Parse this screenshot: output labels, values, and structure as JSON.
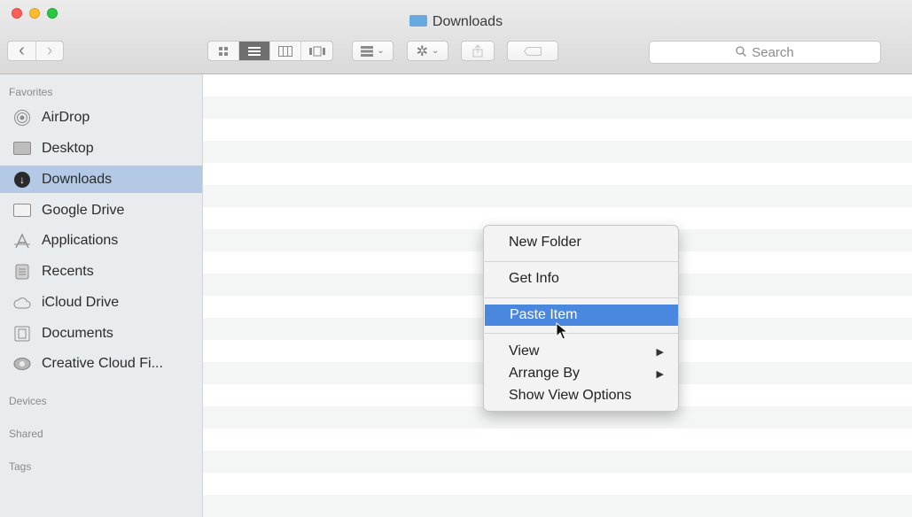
{
  "window": {
    "title": "Downloads"
  },
  "toolbar": {
    "back_icon": "‹",
    "forward_icon": "›",
    "view_modes": [
      "icon-view-icon",
      "list-view-icon",
      "column-view-icon",
      "gallery-view-icon"
    ],
    "active_view": "list",
    "search_placeholder": "Search"
  },
  "sidebar": {
    "favorites_label": "Favorites",
    "items": [
      {
        "label": "AirDrop",
        "icon": "airdrop-icon"
      },
      {
        "label": "Desktop",
        "icon": "desktop-icon"
      },
      {
        "label": "Downloads",
        "icon": "downloads-icon",
        "selected": true
      },
      {
        "label": "Google Drive",
        "icon": "folder-icon"
      },
      {
        "label": "Applications",
        "icon": "applications-icon"
      },
      {
        "label": "Recents",
        "icon": "recents-icon"
      },
      {
        "label": "iCloud Drive",
        "icon": "cloud-icon"
      },
      {
        "label": "Documents",
        "icon": "documents-icon"
      },
      {
        "label": "Creative Cloud Fi...",
        "icon": "creative-cloud-icon"
      }
    ],
    "devices_label": "Devices",
    "shared_label": "Shared",
    "tags_label": "Tags"
  },
  "context_menu": {
    "new_folder": "New Folder",
    "get_info": "Get Info",
    "paste_item": "Paste Item",
    "view": "View",
    "arrange_by": "Arrange By",
    "show_view_options": "Show View Options",
    "highlighted": "Paste Item",
    "highlight_color": "#4a88e0"
  },
  "colors": {
    "selected_sidebar": "#b3c9e6",
    "sidebar_bg": "#e9ecef"
  }
}
